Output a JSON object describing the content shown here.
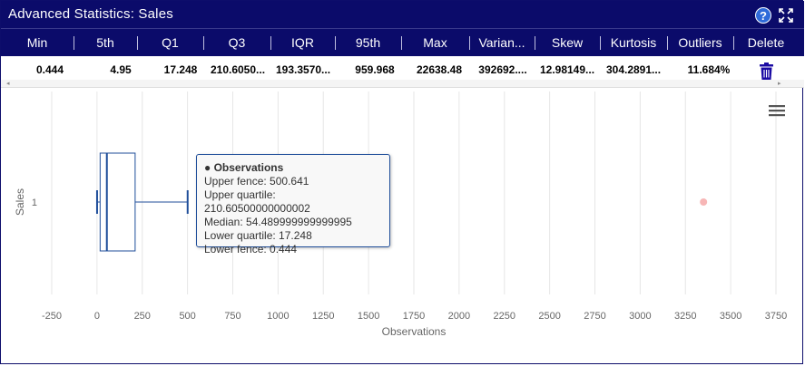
{
  "window": {
    "title": "Advanced Statistics: Sales",
    "help_label": "?",
    "help_icon": "help-icon",
    "expand_icon": "expand-icon"
  },
  "table": {
    "headers": [
      "Min",
      "5th",
      "Q1",
      "Q3",
      "IQR",
      "95th",
      "Max",
      "Varian...",
      "Skew",
      "Kurtosis",
      "Outliers",
      "Delete"
    ],
    "row": [
      "0.444",
      "4.95",
      "17.248",
      "210.6050...",
      "193.3570...",
      "959.968",
      "22638.48",
      "392692....",
      "12.98149...",
      "304.2891...",
      "11.684%"
    ],
    "delete_icon": "trash-icon",
    "delete_color": "#1a0aa3"
  },
  "scroll": {
    "left": "◂",
    "right": "▸"
  },
  "chart_data": {
    "type": "boxplot",
    "series_name": "Observations",
    "category": "1",
    "ylabel": "Sales",
    "xlabel": "Observations",
    "xlim": [
      -250,
      3750
    ],
    "xticks": [
      -250,
      0,
      250,
      500,
      750,
      1000,
      1250,
      1500,
      1750,
      2000,
      2250,
      2500,
      2750,
      3000,
      3250,
      3500,
      3750
    ],
    "box": {
      "lower_fence": 0.444,
      "q1": 17.248,
      "median": 54.489999999999995,
      "q3": 210.60500000000002,
      "upper_fence": 500.641
    },
    "outliers": [
      3350
    ],
    "grid": true,
    "box_color": "#1f4e9a",
    "outlier_color": "#f7b6b6"
  },
  "tooltip": {
    "title": "● Observations",
    "lines": [
      "Upper fence: 500.641",
      "Upper quartile: 210.60500000000002",
      "Median: 54.489999999999995",
      "Lower quartile: 17.248",
      "Lower fence: 0.444"
    ]
  },
  "menu_icon": "hamburger-menu-icon"
}
